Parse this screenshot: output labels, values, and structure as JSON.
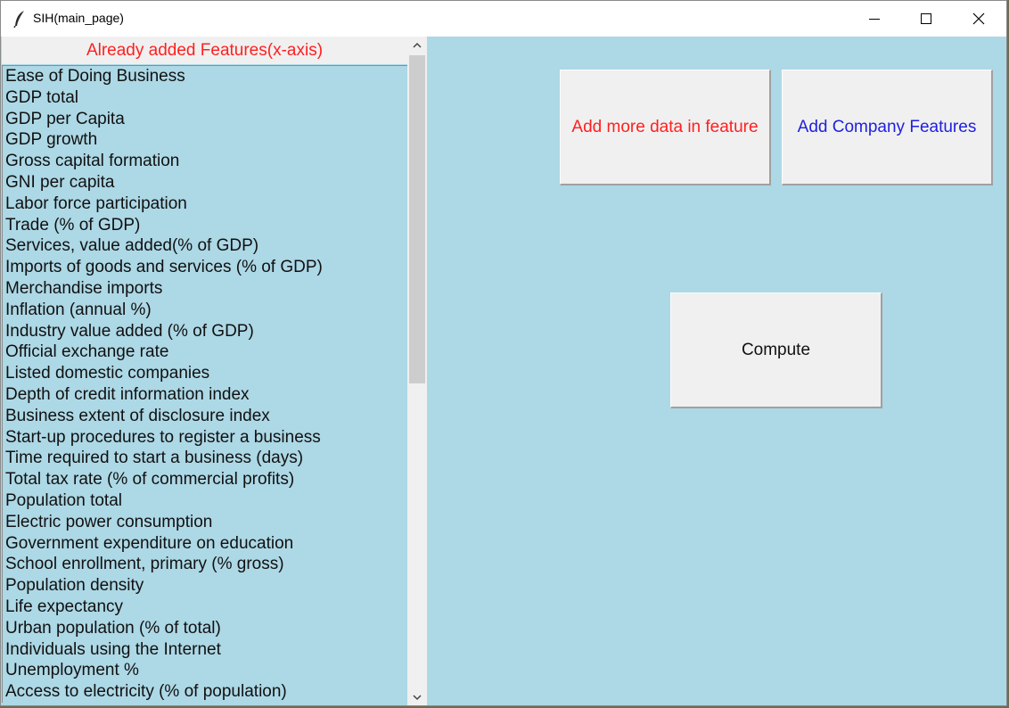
{
  "window": {
    "title": "SIH(main_page)",
    "icon": "tk-feather-icon"
  },
  "features_panel": {
    "header": "Already added Features(x-axis)",
    "items": [
      "Ease of Doing Business",
      "GDP total",
      "GDP per Capita",
      "GDP growth",
      "Gross capital formation",
      "GNI per capita",
      "Labor force participation",
      "Trade (% of GDP)",
      "Services, value added(% of GDP)",
      "Imports of goods and services (% of GDP)",
      "Merchandise imports",
      "Inflation (annual %)",
      "Industry value added (% of GDP)",
      "Official exchange rate",
      "Listed domestic companies",
      "Depth of credit information index",
      "Business extent of disclosure index",
      "Start-up procedures to register a business",
      "Time required to start a business (days)",
      "Total tax rate (% of commercial profits)",
      "Population total",
      "Electric power consumption",
      "Government expenditure on education",
      "School enrollment, primary (% gross)",
      "Population density",
      "Life expectancy",
      "Urban population (% of total)",
      "Individuals using the Internet",
      "Unemployment %",
      "Access to electricity (% of population)"
    ]
  },
  "buttons": {
    "add_data": "Add more data in feature",
    "add_company": "Add Company Features",
    "compute": "Compute"
  },
  "colors": {
    "background": "#add8e6",
    "header_text": "#ff2020",
    "add_data_text": "#ff2020",
    "add_company_text": "#2020e0"
  }
}
